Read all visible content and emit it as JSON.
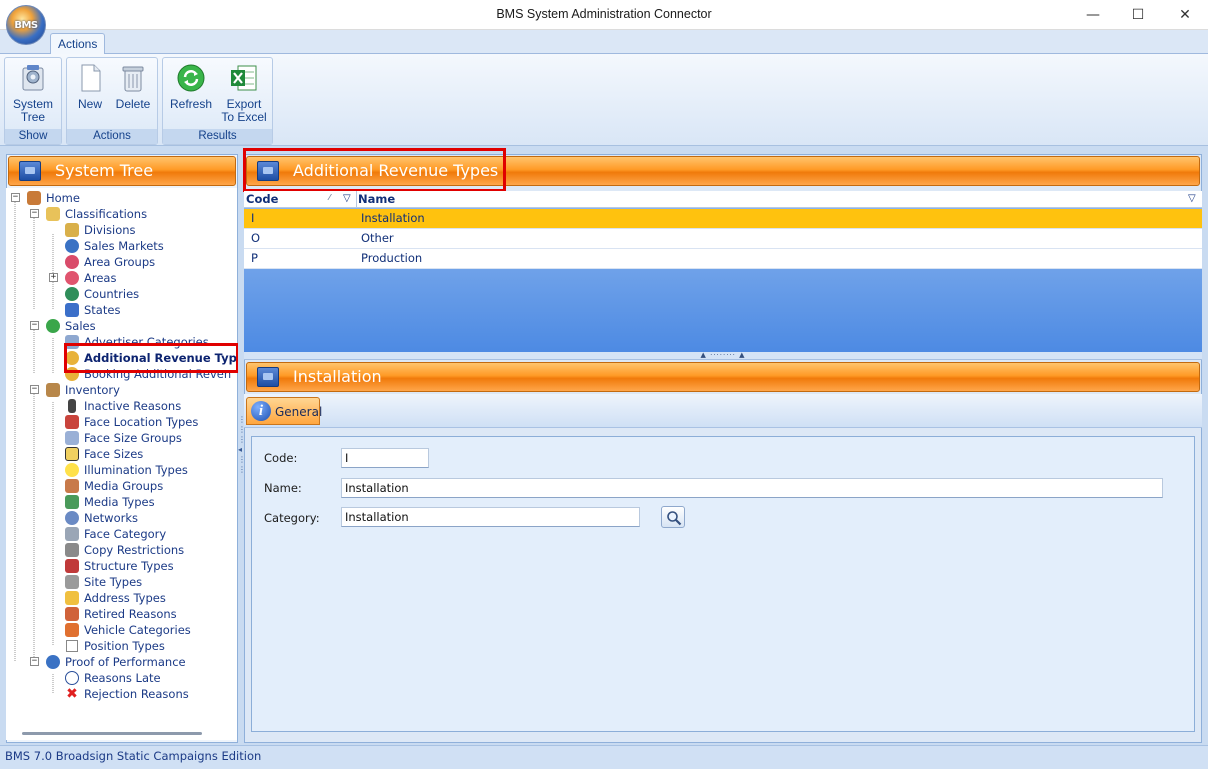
{
  "window": {
    "title": "BMS System Administration Connector",
    "orb_text": "BMS",
    "minimize": "—",
    "maximize": "☐",
    "close": "✕"
  },
  "ribbon": {
    "tab": "Actions",
    "groups": [
      {
        "label": "Show",
        "buttons": [
          {
            "label_line1": "System",
            "label_line2": "Tree",
            "icon": "system-tree-icon"
          }
        ]
      },
      {
        "label": "Actions",
        "buttons": [
          {
            "label_line1": "New",
            "icon": "new-document-icon"
          },
          {
            "label_line1": "Delete",
            "icon": "trash-icon"
          }
        ]
      },
      {
        "label": "Results",
        "buttons": [
          {
            "label_line1": "Refresh",
            "icon": "refresh-icon"
          },
          {
            "label_line1": "Export",
            "label_line2": "To Excel",
            "icon": "excel-icon"
          }
        ]
      }
    ]
  },
  "left_panel": {
    "title": "System Tree",
    "tree": [
      {
        "label": "Home",
        "icon": "home-icon"
      },
      {
        "label": "Classifications",
        "icon": "folder-icon"
      },
      {
        "label": "Divisions",
        "icon": "divisions-icon"
      },
      {
        "label": "Sales Markets",
        "icon": "globe-icon"
      },
      {
        "label": "Area Groups",
        "icon": "area-groups-icon"
      },
      {
        "label": "Areas",
        "icon": "areas-icon"
      },
      {
        "label": "Countries",
        "icon": "globe-icon"
      },
      {
        "label": "States",
        "icon": "puzzle-icon"
      },
      {
        "label": "Sales",
        "icon": "money-icon"
      },
      {
        "label": "Advertiser Categories",
        "icon": "category-icon"
      },
      {
        "label": "Additional Revenue Typ",
        "icon": "coin-icon"
      },
      {
        "label": "Booking Additional Reven",
        "icon": "coin-icon"
      },
      {
        "label": "Inventory",
        "icon": "box-icon"
      },
      {
        "label": "Inactive Reasons",
        "icon": "traffic-light-icon"
      },
      {
        "label": "Face Location Types",
        "icon": "house-icon"
      },
      {
        "label": "Face Size Groups",
        "icon": "size-groups-icon"
      },
      {
        "label": "Face Sizes",
        "icon": "resize-icon"
      },
      {
        "label": "Illumination Types",
        "icon": "bulb-icon"
      },
      {
        "label": "Media Groups",
        "icon": "media-groups-icon"
      },
      {
        "label": "Media Types",
        "icon": "media-types-icon"
      },
      {
        "label": "Networks",
        "icon": "network-icon"
      },
      {
        "label": "Face Category",
        "icon": "face-category-icon"
      },
      {
        "label": "Copy Restrictions",
        "icon": "lock-icon"
      },
      {
        "label": "Structure Types",
        "icon": "structure-icon"
      },
      {
        "label": "Site Types",
        "icon": "site-icon"
      },
      {
        "label": "Address Types",
        "icon": "envelope-icon"
      },
      {
        "label": "Retired Reasons",
        "icon": "retired-icon"
      },
      {
        "label": "Vehicle Categories",
        "icon": "vehicle-icon"
      },
      {
        "label": "Position Types",
        "icon": "crosshair-icon"
      },
      {
        "label": "Proof of Performance",
        "icon": "globe-icon"
      },
      {
        "label": "Reasons Late",
        "icon": "clock-icon"
      },
      {
        "label": "Rejection Reasons",
        "icon": "red-x-icon"
      }
    ]
  },
  "grid": {
    "title": "Additional Revenue Types",
    "columns": [
      "Code",
      "Name"
    ],
    "rows": [
      {
        "code": "I",
        "name": "Installation"
      },
      {
        "code": "O",
        "name": "Other"
      },
      {
        "code": "P",
        "name": "Production"
      }
    ],
    "selected_index": 0
  },
  "detail": {
    "title": "Installation",
    "tab": "General",
    "fields": {
      "code_label": "Code:",
      "code_value": "I",
      "name_label": "Name:",
      "name_value": "Installation",
      "category_label": "Category:",
      "category_value": "Installation"
    }
  },
  "status": {
    "text": "BMS 7.0 Broadsign Static Campaigns  Edition"
  },
  "colors": {
    "header_orange": "#ff9a26",
    "selected_row": "#ffc20e",
    "highlight_red": "#e00000"
  }
}
